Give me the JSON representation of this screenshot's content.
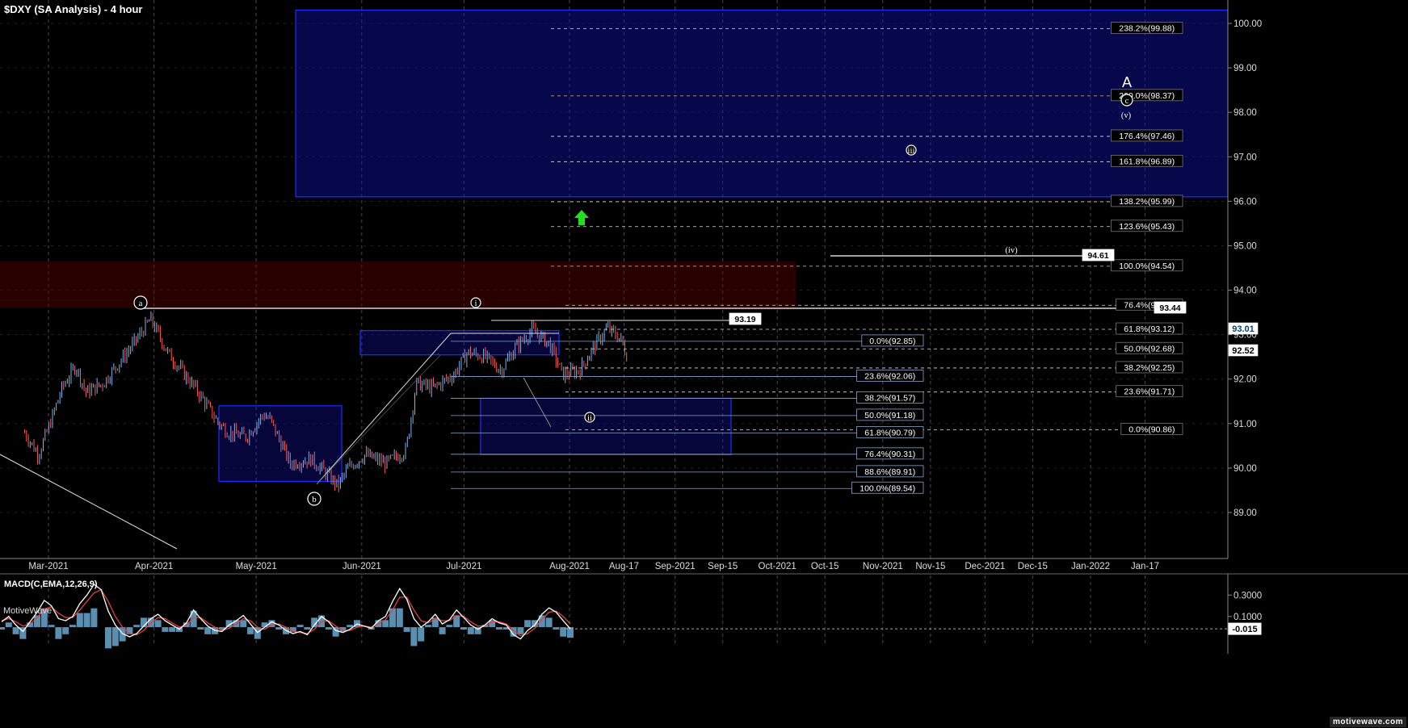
{
  "header": {
    "title": "$DXY (SA Analysis) - 4 hour"
  },
  "branding": {
    "app_name": "MotiveWave",
    "site": "motivewave.com"
  },
  "colors": {
    "background": "#000000",
    "grid": "#4a4a4a",
    "up_candle": "#7ab4ea",
    "down_candle": "#ff5a5a",
    "target_box": "#1010a8",
    "resistance_box": "#5a0000",
    "fib_line_white": "#dddddd",
    "fib_line_blue": "#8aa4c8",
    "arrow": "#22dd22",
    "macd_line": "#ffffff",
    "signal_line": "#e04040",
    "histogram": "#6aa8d0"
  },
  "chart_data": [
    {
      "type": "candlestick",
      "title": "$DXY (SA Analysis) - 4 hour",
      "ylim": [
        88.0,
        100.3
      ],
      "y_ticks": [
        "89.00",
        "90.00",
        "91.00",
        "92.00",
        "93.00",
        "94.00",
        "95.00",
        "96.00",
        "97.00",
        "98.00",
        "99.00",
        "100.00"
      ],
      "x_ticks": [
        "Mar-2021",
        "Apr-2021",
        "May-2021",
        "Jun-2021",
        "Jul-2021",
        "Aug-2021",
        "Aug-17",
        "Sep-2021",
        "Sep-15",
        "Oct-2021",
        "Oct-15",
        "Nov-2021",
        "Nov-15",
        "Dec-2021",
        "Dec-15",
        "Jan-2022",
        "Jan-17"
      ],
      "price_path": [
        [
          "2021-02-22",
          90.8
        ],
        [
          "2021-02-26",
          90.3
        ],
        [
          "2021-03-01",
          90.9
        ],
        [
          "2021-03-05",
          91.8
        ],
        [
          "2021-03-09",
          92.3
        ],
        [
          "2021-03-12",
          91.7
        ],
        [
          "2021-03-17",
          91.9
        ],
        [
          "2021-03-22",
          92.4
        ],
        [
          "2021-03-26",
          92.8
        ],
        [
          "2021-03-31",
          93.35
        ],
        [
          "2021-04-05",
          92.6
        ],
        [
          "2021-04-09",
          92.2
        ],
        [
          "2021-04-14",
          91.7
        ],
        [
          "2021-04-20",
          91.0
        ],
        [
          "2021-04-23",
          90.8
        ],
        [
          "2021-04-28",
          90.7
        ],
        [
          "2021-05-03",
          91.2
        ],
        [
          "2021-05-05",
          91.1
        ],
        [
          "2021-05-11",
          90.1
        ],
        [
          "2021-05-17",
          90.2
        ],
        [
          "2021-05-20",
          90.0
        ],
        [
          "2021-05-25",
          89.6
        ],
        [
          "2021-05-28",
          90.0
        ],
        [
          "2021-06-02",
          90.3
        ],
        [
          "2021-06-08",
          90.1
        ],
        [
          "2021-06-14",
          90.4
        ],
        [
          "2021-06-17",
          91.9
        ],
        [
          "2021-06-22",
          91.8
        ],
        [
          "2021-06-28",
          92.1
        ],
        [
          "2021-07-02",
          92.6
        ],
        [
          "2021-07-07",
          92.5
        ],
        [
          "2021-07-12",
          92.2
        ],
        [
          "2021-07-16",
          92.7
        ],
        [
          "2021-07-21",
          93.1
        ],
        [
          "2021-07-26",
          92.8
        ],
        [
          "2021-07-30",
          92.1
        ],
        [
          "2021-08-04",
          92.2
        ],
        [
          "2021-08-08",
          92.7
        ],
        [
          "2021-08-12",
          93.15
        ],
        [
          "2021-08-16",
          92.9
        ],
        [
          "2021-08-18",
          92.5
        ]
      ],
      "last_price": "92.52",
      "price_tags": [
        "93.01",
        "92.52",
        "93.44"
      ],
      "callouts": [
        "93.19",
        "94.61"
      ],
      "wave_labels": [
        "a",
        "b",
        "i",
        "ii",
        "iii",
        "iv",
        "v",
        "c",
        "A"
      ],
      "fib_labels_upper": [
        "238.2%(99.88)",
        "200.0%(98.37)",
        "176.4%(97.46)",
        "161.8%(96.89)",
        "138.2%(95.99)",
        "123.6%(95.43)",
        "100.0%(94.54)",
        "76.4%(93.66)",
        "61.8%(93.12)",
        "50.0%(92.68)",
        "38.2%(92.25)",
        "23.6%(91.71)",
        "0.0%(90.86)"
      ],
      "fib_labels_lower": [
        "0.0%(92.85)",
        "23.6%(92.06)",
        "38.2%(91.57)",
        "50.0%(91.18)",
        "61.8%(90.79)",
        "76.4%(90.31)",
        "88.6%(89.91)",
        "100.0%(89.54)"
      ],
      "target_zone": [
        96.1,
        100.3
      ],
      "resistance_zone": [
        93.6,
        94.65
      ],
      "support_zone": [
        90.3,
        91.57
      ],
      "consolidation_zones": [
        [
          89.7,
          91.4
        ],
        [
          92.6,
          93.0
        ]
      ],
      "grid": true
    },
    {
      "type": "line",
      "title": "MACD(C,EMA,12,26,9)",
      "ylim": [
        -0.12,
        0.43
      ],
      "y_ticks": [
        "0.3000",
        "0.1000"
      ],
      "last_value": "-0.015",
      "series": [
        {
          "values": [
            0.05,
            0.1,
            0.02,
            -0.04,
            0.05,
            0.14,
            0.25,
            0.2,
            0.08,
            0.06,
            0.1,
            0.22,
            0.3,
            0.4,
            0.35,
            0.15,
            0.02,
            -0.06,
            -0.09,
            -0.06,
            0.01,
            0.08,
            0.12,
            0.06,
            0.02,
            -0.02,
            0.04,
            0.16,
            0.08,
            0.01,
            -0.03,
            -0.04,
            0.02,
            0.06,
            0.11,
            0.03,
            -0.05,
            0.0,
            0.05,
            0.02,
            -0.03,
            -0.06,
            -0.04,
            -0.07,
            0.02,
            0.1,
            0.05,
            -0.03,
            -0.05,
            -0.02,
            0.03,
            0.01,
            -0.01,
            0.06,
            0.1,
            0.24,
            0.36,
            0.26,
            0.08,
            0.0,
            0.05,
            0.12,
            0.03,
            0.07,
            0.16,
            0.09,
            0.02,
            -0.02,
            0.02,
            0.08,
            0.04,
            0.02,
            -0.07,
            -0.11,
            -0.03,
            0.02,
            0.12,
            0.18,
            0.14,
            0.06,
            -0.015
          ]
        },
        {
          "values": [
            0.06,
            0.08,
            0.05,
            0.01,
            0.03,
            0.09,
            0.17,
            0.19,
            0.13,
            0.09,
            0.09,
            0.16,
            0.24,
            0.32,
            0.35,
            0.24,
            0.1,
            0.0,
            -0.06,
            -0.07,
            -0.03,
            0.04,
            0.09,
            0.08,
            0.04,
            0.0,
            0.02,
            0.09,
            0.09,
            0.04,
            0.0,
            -0.03,
            -0.01,
            0.03,
            0.08,
            0.06,
            0.0,
            -0.02,
            0.02,
            0.03,
            0.0,
            -0.04,
            -0.05,
            -0.06,
            -0.02,
            0.05,
            0.06,
            0.01,
            -0.03,
            -0.03,
            0.0,
            0.01,
            0.0,
            0.03,
            0.07,
            0.16,
            0.28,
            0.28,
            0.16,
            0.06,
            0.04,
            0.08,
            0.06,
            0.06,
            0.11,
            0.1,
            0.05,
            0.01,
            0.01,
            0.05,
            0.05,
            0.03,
            -0.03,
            -0.08,
            -0.06,
            -0.01,
            0.07,
            0.14,
            0.15,
            0.1,
            0.03
          ]
        }
      ],
      "grid": true
    }
  ]
}
